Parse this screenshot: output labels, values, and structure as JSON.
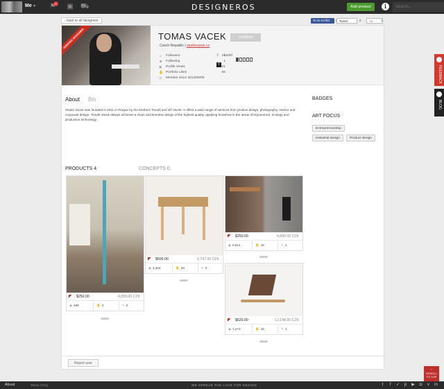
{
  "topbar": {
    "me_label": "Me",
    "notifications_count": "37",
    "logo": "DESIGNEROS",
    "add_product_label": "Add product",
    "search_placeholder": "Search..."
  },
  "back_link": "back to all designers",
  "share": {
    "facebook": "To se mi líbí",
    "facebook_count": "6",
    "tweet": "Tweet",
    "tweet_count": "0",
    "gplus": "+1",
    "gplus_count": "1"
  },
  "profile": {
    "ribbon": "VERIFIED DESIGNER",
    "name": "TOMAS VACEK",
    "country": "Czech Republic",
    "separator": "|",
    "website": "studiovacek.cz",
    "unfollow_label": "Unfollow",
    "level_label": "Level",
    "level_filled": 1,
    "level_total": 5,
    "stats": [
      {
        "icon": "users-icon",
        "label": "Followers",
        "value": "24"
      },
      {
        "icon": "user-icon",
        "label": "Following",
        "value": "1"
      },
      {
        "icon": "eye-icon",
        "label": "Profile Views",
        "value": "2921"
      },
      {
        "icon": "thumb-icon",
        "label": "Portfolio Likes",
        "value": "60"
      },
      {
        "icon": "clock-icon",
        "label": "Member since 2013/06/05",
        "value": ""
      }
    ]
  },
  "about": {
    "tab_about": "About",
    "tab_bio": "Bio",
    "text": "Studio Vacek was founded in 2011 in Prague by the brothers Tomáš and Jiří Vacek. It offers a wide range of services from product design, photography, interior and corporate design. Tomáš Vacek always achieves a clean and timeless design of the highest quality, applying knowhow in the areas of ergonomics, ecology and production technology."
  },
  "sidebar": {
    "badges_heading": "BADGES",
    "art_focus_heading": "ART FOCUS",
    "tags": [
      "Entrepreneurship",
      "Industrial design",
      "Product design"
    ]
  },
  "tabs": {
    "products": "PRODUCTS 4",
    "concepts": "CONCEPTS 0"
  },
  "products": [
    {
      "price": "$250.00",
      "czk": "4,899.00 CZK",
      "views": "499",
      "likes": "4",
      "comments": "0"
    },
    {
      "price": "$500.00",
      "czk": "9,797.00 CZK",
      "views": "4,154",
      "likes": "20",
      "comments": "0"
    },
    {
      "price": "$250.00",
      "czk": "4,899.00 CZK",
      "views": "6,514",
      "likes": "18",
      "comments": "1"
    },
    {
      "price": "$620.00",
      "czk": "12,148.00 CZK",
      "views": "7,273",
      "likes": "18",
      "comments": "1"
    }
  ],
  "report_label": "Report user",
  "side": {
    "feedback": "FEEDBACK",
    "blog": "BLOG"
  },
  "scroll_top": "SCROLL TO TOP",
  "footer": {
    "about": "About",
    "links": "Terms | FAQ",
    "motto": "WE SPREAD THE LOVE FOR DESIGN"
  }
}
